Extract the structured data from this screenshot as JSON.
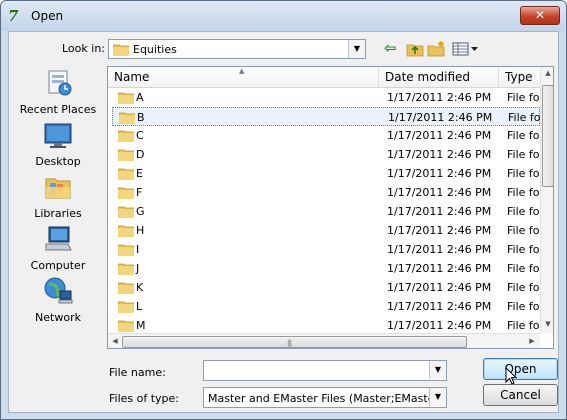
{
  "window": {
    "title": "Open",
    "close_label": "✕"
  },
  "toolbar": {
    "look_in_label": "Look in:",
    "look_in_value": "Equities"
  },
  "places": [
    {
      "label": "Recent Places",
      "icon": "recent-places-icon"
    },
    {
      "label": "Desktop",
      "icon": "desktop-icon"
    },
    {
      "label": "Libraries",
      "icon": "libraries-icon"
    },
    {
      "label": "Computer",
      "icon": "computer-icon"
    },
    {
      "label": "Network",
      "icon": "network-icon"
    }
  ],
  "columns": {
    "name": "Name",
    "date": "Date modified",
    "type": "Type"
  },
  "rows": [
    {
      "name": "A",
      "date": "1/17/2011 2:46 PM",
      "type": "File fol"
    },
    {
      "name": "B",
      "date": "1/17/2011 2:46 PM",
      "type": "File fol",
      "selected": true
    },
    {
      "name": "C",
      "date": "1/17/2011 2:46 PM",
      "type": "File fol"
    },
    {
      "name": "D",
      "date": "1/17/2011 2:46 PM",
      "type": "File fol"
    },
    {
      "name": "E",
      "date": "1/17/2011 2:46 PM",
      "type": "File fol"
    },
    {
      "name": "F",
      "date": "1/17/2011 2:46 PM",
      "type": "File fol"
    },
    {
      "name": "G",
      "date": "1/17/2011 2:46 PM",
      "type": "File fol"
    },
    {
      "name": "H",
      "date": "1/17/2011 2:46 PM",
      "type": "File fol"
    },
    {
      "name": "I",
      "date": "1/17/2011 2:46 PM",
      "type": "File fol"
    },
    {
      "name": "J",
      "date": "1/17/2011 2:46 PM",
      "type": "File fol"
    },
    {
      "name": "K",
      "date": "1/17/2011 2:46 PM",
      "type": "File fol"
    },
    {
      "name": "L",
      "date": "1/17/2011 2:46 PM",
      "type": "File fol"
    },
    {
      "name": "M",
      "date": "1/17/2011 2:46 PM",
      "type": "File fol"
    }
  ],
  "file_name": {
    "label": "File name:",
    "value": ""
  },
  "files_of_type": {
    "label": "Files of type:",
    "value": "Master and EMaster Files (Master;EMaster)"
  },
  "buttons": {
    "open": "Open",
    "cancel": "Cancel"
  },
  "colors": {
    "folder": "#e8c35a",
    "selection": "#eaf2fb",
    "close": "#c7442b"
  }
}
